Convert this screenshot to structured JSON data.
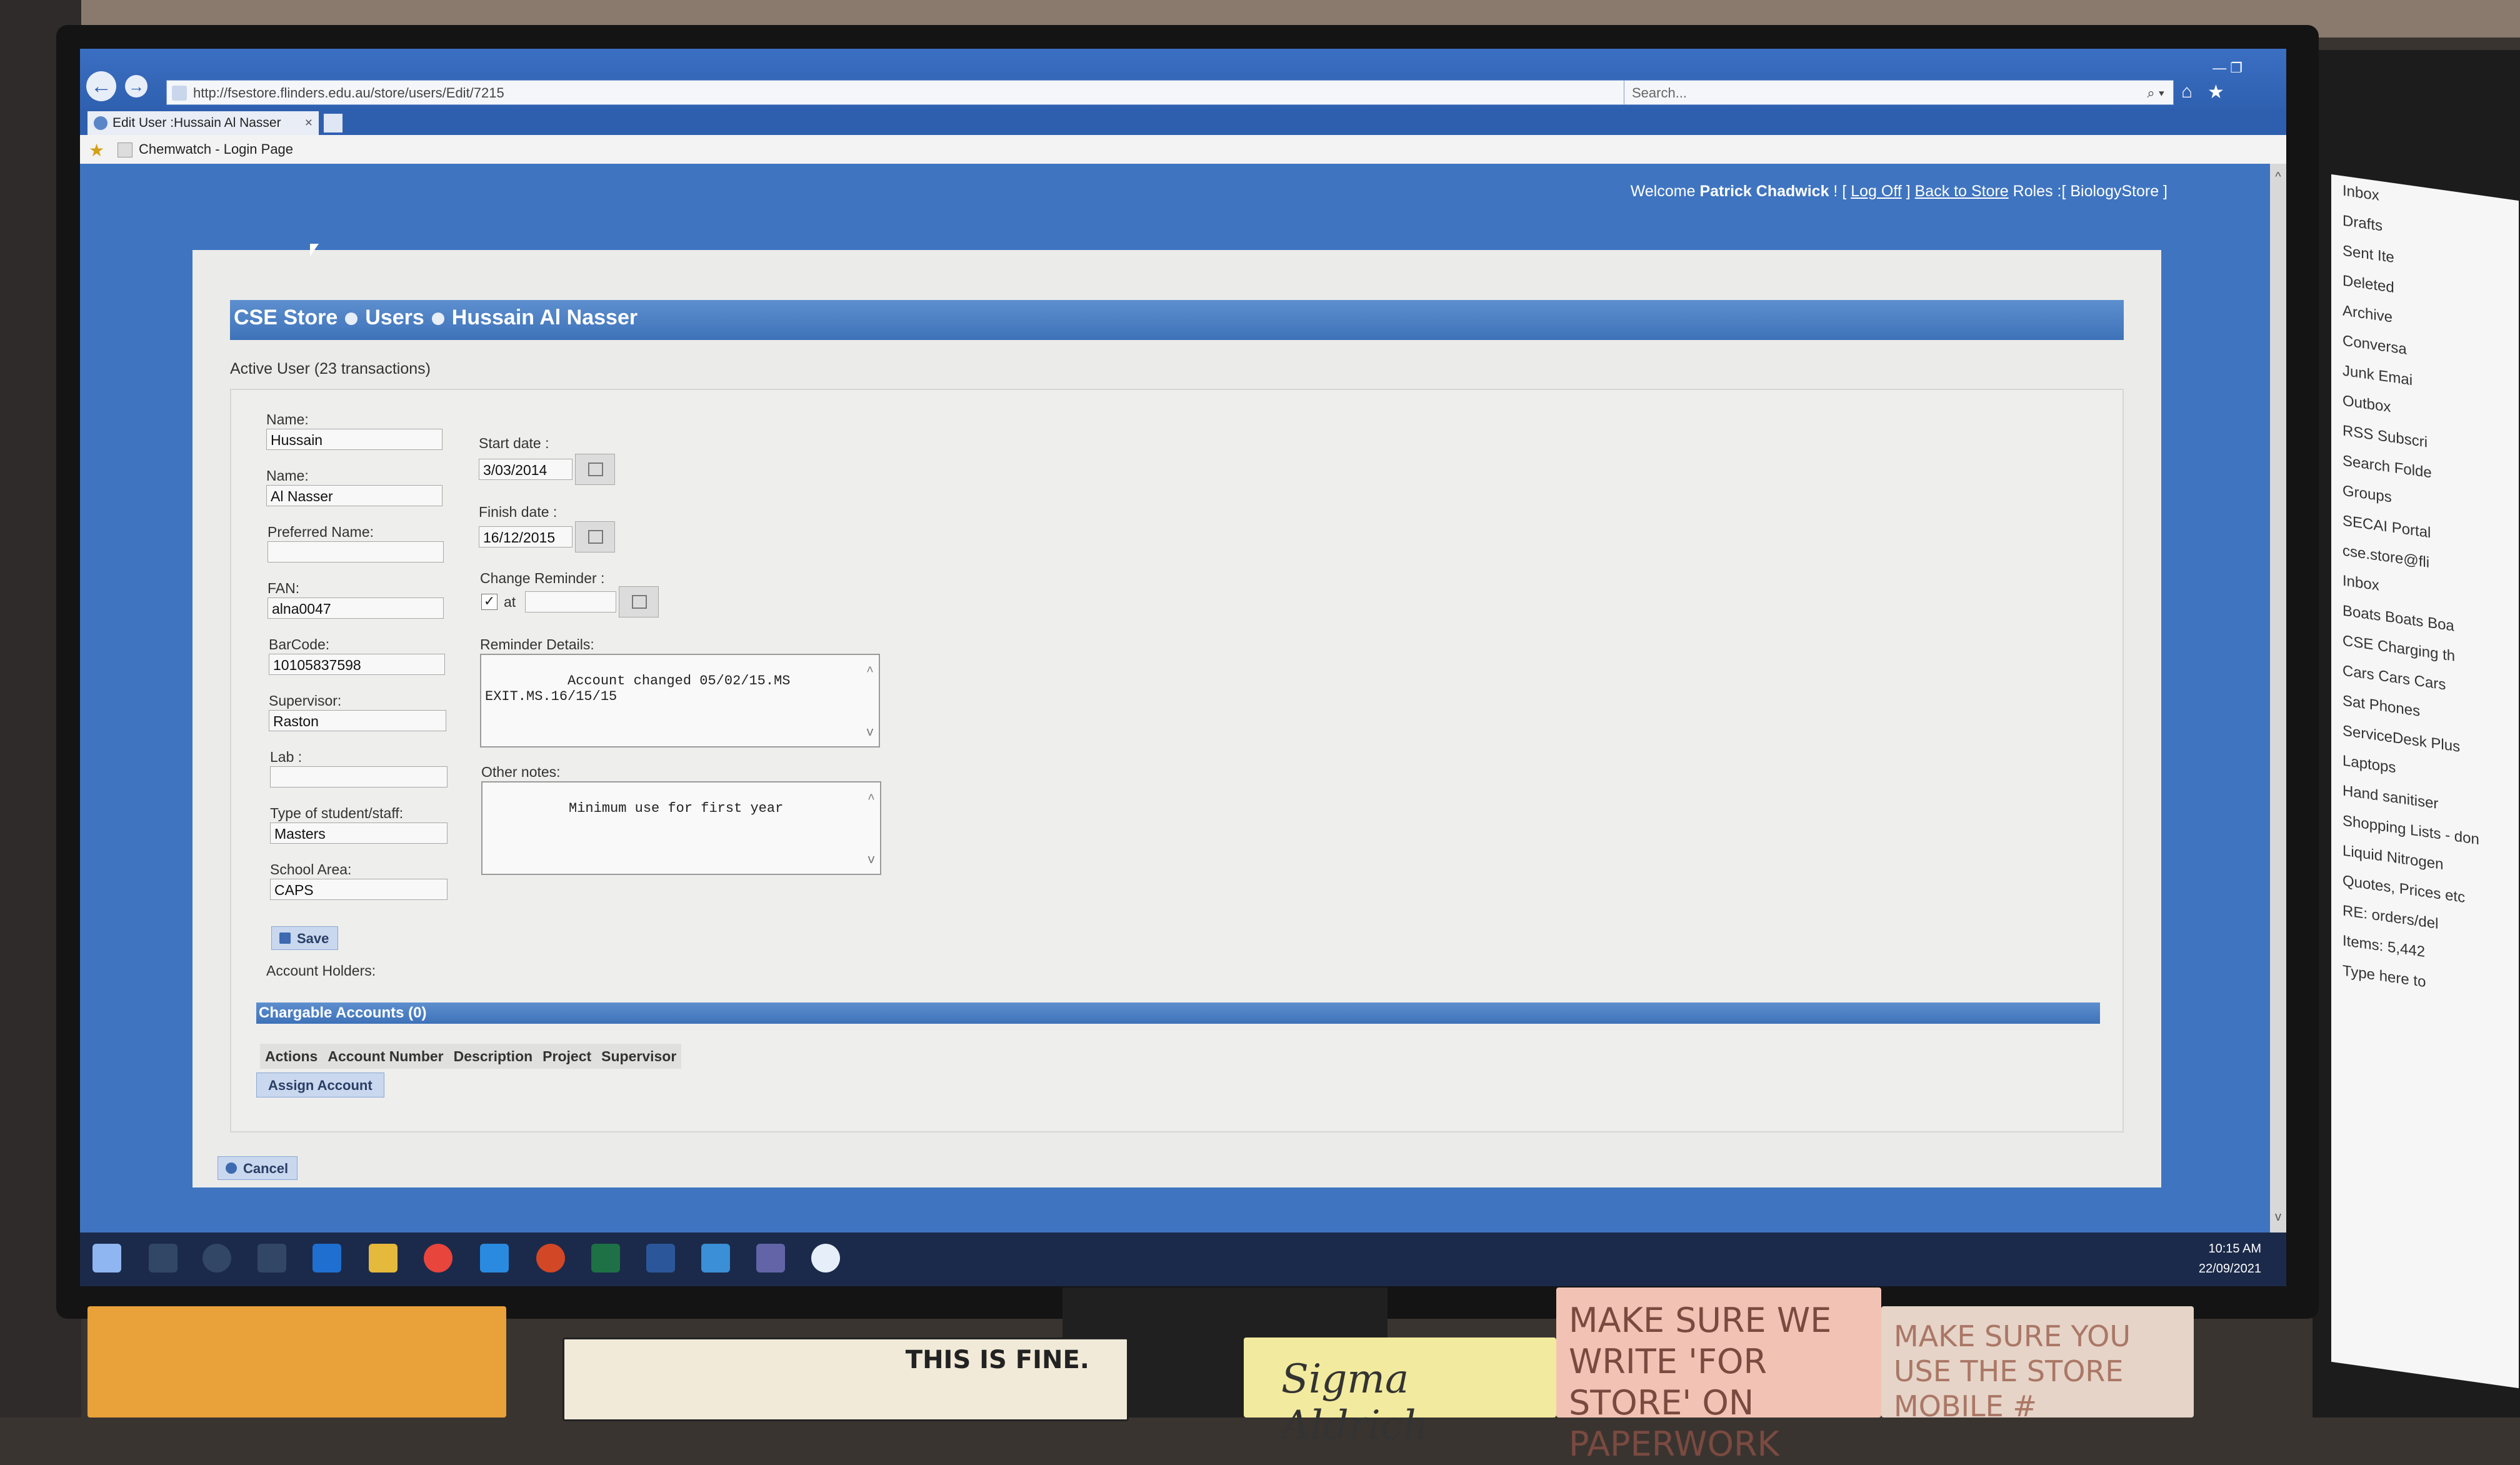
{
  "browser": {
    "url": "http://fsestore.flinders.edu.au/store/users/Edit/7215",
    "search_placeholder": "Search...",
    "tab_title": "Edit User :Hussain Al Nasser",
    "tab_close": "×",
    "favorite": "Chemwatch - Login Page",
    "back_icon": "←",
    "forward_icon": "→",
    "addr_tools": "▾ ↻",
    "search_icon": "⌕ ▾",
    "home_icon": "⌂",
    "star_icon": "★",
    "window_controls": "—   ❐"
  },
  "header": {
    "welcome_prefix": "Welcome",
    "user": "Patrick Chadwick",
    "after_user": "! [",
    "logoff": "Log Off",
    "mid": "]",
    "back_to_store": "Back to Store",
    "roles": "Roles :[ BiologyStore ]"
  },
  "breadcrumb": {
    "store": "CSE Store",
    "users": "Users",
    "user": "Hussain Al Nasser"
  },
  "status": "Active User (23 transactions)",
  "form": {
    "first_name_label": "Name:",
    "first_name": "Hussain",
    "last_name_label": "Name:",
    "last_name": "Al Nasser",
    "preferred_label": "Preferred Name:",
    "preferred": "",
    "fan_label": "FAN:",
    "fan": "alna0047",
    "barcode_label": "BarCode:",
    "barcode": "10105837598",
    "supervisor_label": "Supervisor:",
    "supervisor": "Raston",
    "lab_label": "Lab :",
    "lab": "",
    "type_label": "Type of student/staff:",
    "type": "Masters",
    "school_label": "School Area:",
    "school": "CAPS",
    "start_label": "Start date :",
    "start": "3/03/2014",
    "finish_label": "Finish date :",
    "finish": "16/12/2015",
    "reminder_label": "Change Reminder :",
    "reminder_checked": "✓",
    "reminder_at": "at",
    "reminder_at_value": "",
    "details_label": "Reminder Details:",
    "details": "Account changed 05/02/15.MS\nEXIT.MS.16/15/15",
    "notes_label": "Other notes:",
    "notes": "Minimum use for first year",
    "scroll_up": "^",
    "scroll_down": "v",
    "save": "Save",
    "account_holders": "Account Holders:"
  },
  "accounts": {
    "title": "Chargable Accounts (0)",
    "columns": [
      "Actions",
      "Account Number",
      "Description",
      "Project",
      "Supervisor"
    ],
    "assign": "Assign Account"
  },
  "cancel": "Cancel",
  "taskbar": {
    "time": "10:15 AM",
    "date": "22/09/2021"
  },
  "scroll": {
    "up": "^",
    "down": "v"
  },
  "outlook_folders": [
    "Inbox",
    "Drafts",
    "Sent Ite",
    "Deleted",
    "Archive",
    "Conversa",
    "Junk Emai",
    "Outbox",
    "RSS Subscri",
    "Search Folde",
    "Groups",
    "SECAI Portal",
    "cse.store@fli",
    "Inbox",
    "Boats Boats Boa",
    "CSE Charging th",
    "Cars Cars Cars",
    "Sat Phones",
    "ServiceDesk Plus",
    "Laptops",
    "Hand sanitiser",
    "Shopping Lists - don",
    "Liquid Nitrogen",
    "Quotes, Prices etc",
    "RE: orders/del",
    "Items: 5,442",
    "Type here to"
  ],
  "notes": {
    "comic": "THIS IS FINE.",
    "sigma": "Sigma Aldrich",
    "pink": "MAKE SURE WE WRITE 'FOR STORE' ON PAPERWORK",
    "pink2": "MAKE SURE YOU USE THE STORE MOBILE #"
  },
  "colors": {
    "accent": "#3e72b8",
    "panel": "#ebebe9",
    "taskbar": "#1b2a4a"
  }
}
